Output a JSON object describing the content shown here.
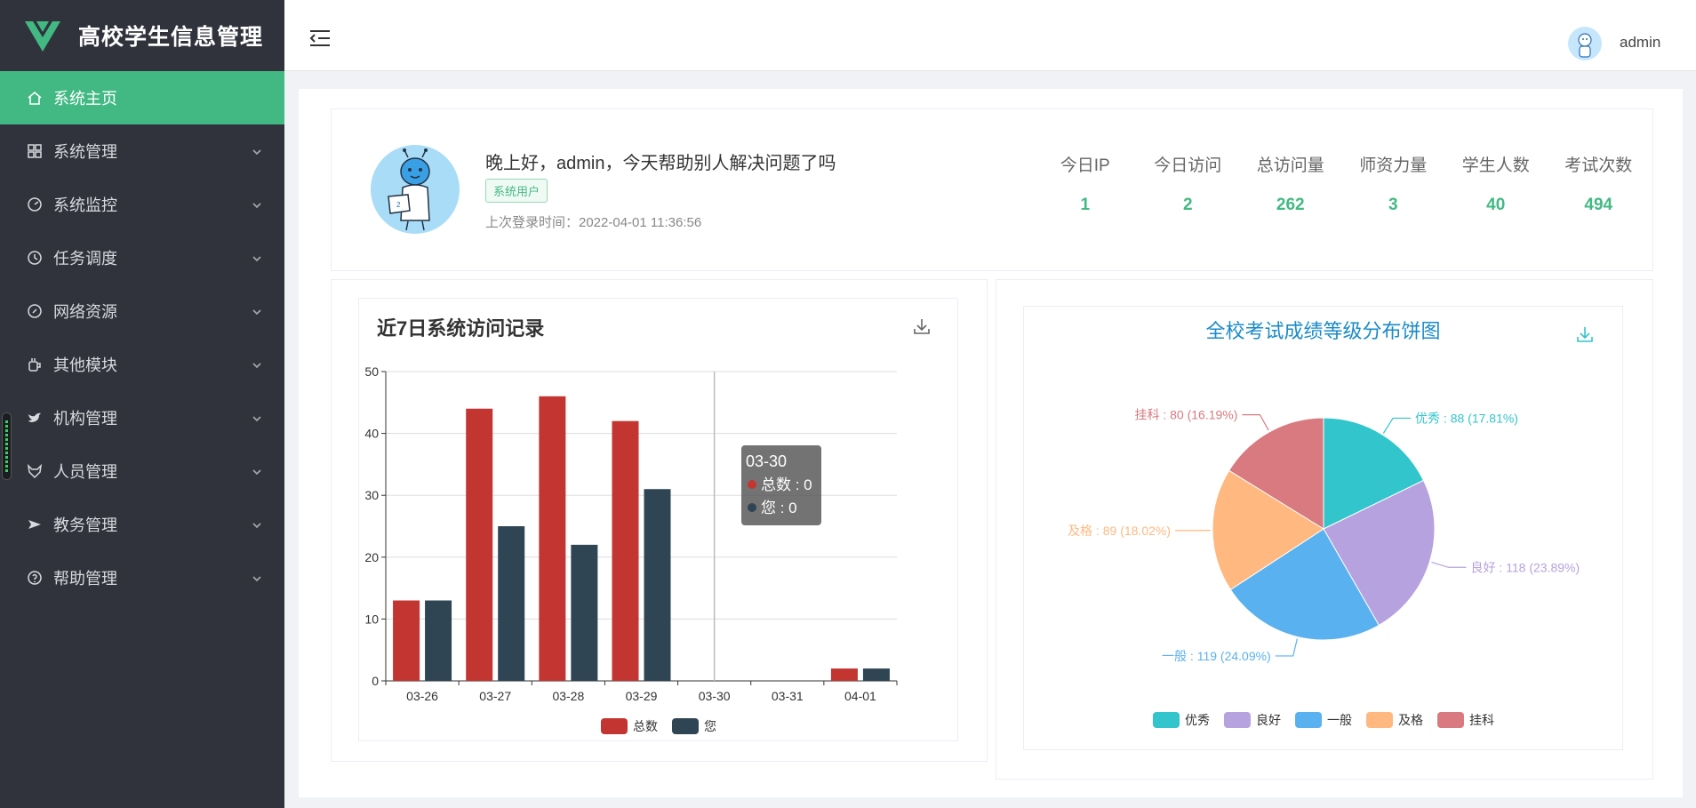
{
  "app": {
    "title": "高校学生信息管理"
  },
  "sidebar": {
    "items": [
      {
        "label": "系统主页",
        "icon": "home-icon",
        "active": true
      },
      {
        "label": "系统管理",
        "icon": "grid-icon"
      },
      {
        "label": "系统监控",
        "icon": "dashboard-icon"
      },
      {
        "label": "任务调度",
        "icon": "clock-icon"
      },
      {
        "label": "网络资源",
        "icon": "compass-icon"
      },
      {
        "label": "其他模块",
        "icon": "cup-icon"
      },
      {
        "label": "机构管理",
        "icon": "bird-icon"
      },
      {
        "label": "人员管理",
        "icon": "fox-icon"
      },
      {
        "label": "教务管理",
        "icon": "plane-icon"
      },
      {
        "label": "帮助管理",
        "icon": "question-icon"
      }
    ]
  },
  "header": {
    "username": "admin"
  },
  "welcome": {
    "greeting": "晚上好，admin，今天帮助别人解决问题了吗",
    "tag": "系统用户",
    "last_login": "上次登录时间：2022-04-01 11:36:56"
  },
  "stats": [
    {
      "label": "今日IP",
      "value": "1"
    },
    {
      "label": "今日访问",
      "value": "2"
    },
    {
      "label": "总访问量",
      "value": "262"
    },
    {
      "label": "师资力量",
      "value": "3"
    },
    {
      "label": "学生人数",
      "value": "40"
    },
    {
      "label": "考试次数",
      "value": "494"
    }
  ],
  "colors": {
    "accent": "#42b983",
    "sidebar": "#30333c",
    "bar_total": "#c23531",
    "bar_you": "#2f4554"
  },
  "chart_data": [
    {
      "type": "bar",
      "title": "近7日系统访问记录",
      "categories": [
        "03-26",
        "03-27",
        "03-28",
        "03-29",
        "03-30",
        "03-31",
        "04-01"
      ],
      "series": [
        {
          "name": "总数",
          "values": [
            13,
            44,
            46,
            42,
            0,
            0,
            2
          ]
        },
        {
          "name": "您",
          "values": [
            13,
            25,
            22,
            31,
            0,
            0,
            2
          ]
        }
      ],
      "ylim": [
        0,
        50
      ],
      "yticks": [
        0,
        10,
        20,
        30,
        40,
        50
      ],
      "legend": "bottom-center",
      "tooltip": {
        "category": "03-30",
        "lines": [
          "总数 : 0",
          "您 : 0"
        ]
      }
    },
    {
      "type": "pie",
      "title": "全校考试成绩等级分布饼图",
      "slices": [
        {
          "name": "优秀",
          "value": 88,
          "label": "优秀 : 88 (17.81%)",
          "color": "#32c5cb"
        },
        {
          "name": "良好",
          "value": 118,
          "label": "良好 : 118 (23.89%)",
          "color": "#b6a2de"
        },
        {
          "name": "一般",
          "value": 119,
          "label": "一般 : 119 (24.09%)",
          "color": "#5ab1ef"
        },
        {
          "name": "及格",
          "value": 89,
          "label": "及格 : 89 (18.02%)",
          "color": "#ffb980"
        },
        {
          "name": "挂科",
          "value": 80,
          "label": "挂科 : 80 (16.19%)",
          "color": "#d87a80"
        }
      ],
      "legend": "bottom-center"
    }
  ]
}
